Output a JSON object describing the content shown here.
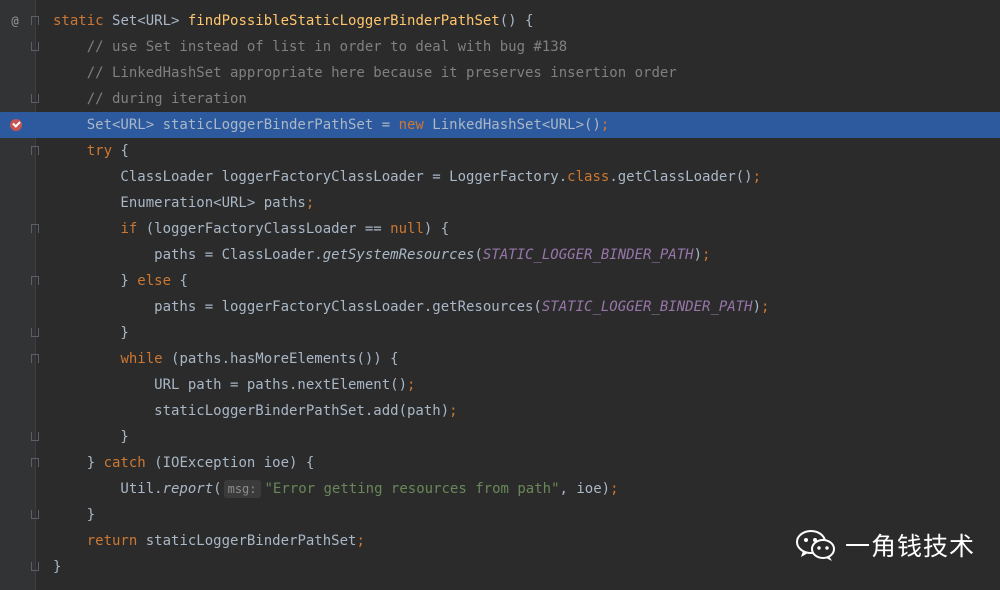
{
  "editor": {
    "lines": [
      {
        "segments": [
          {
            "t": "static ",
            "c": "kw"
          },
          {
            "t": "Set<URL> ",
            "c": ""
          },
          {
            "t": "findPossibleStaticLoggerBinderPathSet",
            "c": "fn"
          },
          {
            "t": "() {",
            "c": ""
          }
        ],
        "gutter": "@",
        "fold": "open"
      },
      {
        "segments": [
          {
            "t": "    // use Set instead of list in order to deal with bug #138",
            "c": "cm"
          }
        ],
        "fold": "line"
      },
      {
        "segments": [
          {
            "t": "    // LinkedHashSet appropriate here because it preserves insertion order",
            "c": "cm"
          }
        ]
      },
      {
        "segments": [
          {
            "t": "    // during iteration",
            "c": "cm"
          }
        ],
        "fold": "close"
      },
      {
        "segments": [
          {
            "t": "    Set<URL> staticLoggerBinderPathSet = ",
            "c": ""
          },
          {
            "t": "new ",
            "c": "kw"
          },
          {
            "t": "LinkedHashSet<URL>()",
            "c": ""
          },
          {
            "t": ";",
            "c": "kw"
          }
        ],
        "breakpoint": true,
        "highlight": true
      },
      {
        "segments": [
          {
            "t": "    ",
            "c": ""
          },
          {
            "t": "try",
            "c": "kw"
          },
          {
            "t": " {",
            "c": ""
          }
        ],
        "fold": "open"
      },
      {
        "segments": [
          {
            "t": "        ClassLoader loggerFactoryClassLoader = LoggerFactory.",
            "c": ""
          },
          {
            "t": "class",
            "c": "kw"
          },
          {
            "t": ".getClassLoader()",
            "c": ""
          },
          {
            "t": ";",
            "c": "kw"
          }
        ]
      },
      {
        "segments": [
          {
            "t": "        Enumeration<URL> paths",
            "c": ""
          },
          {
            "t": ";",
            "c": "kw"
          }
        ]
      },
      {
        "segments": [
          {
            "t": "        ",
            "c": ""
          },
          {
            "t": "if",
            "c": "kw"
          },
          {
            "t": " (loggerFactoryClassLoader == ",
            "c": ""
          },
          {
            "t": "null",
            "c": "kw"
          },
          {
            "t": ") {",
            "c": ""
          }
        ],
        "fold": "open"
      },
      {
        "segments": [
          {
            "t": "            paths = ClassLoader.",
            "c": ""
          },
          {
            "t": "getSystemResources",
            "c": "it"
          },
          {
            "t": "(",
            "c": ""
          },
          {
            "t": "STATIC_LOGGER_BINDER_PATH",
            "c": "st"
          },
          {
            "t": ")",
            "c": ""
          },
          {
            "t": ";",
            "c": "kw"
          }
        ]
      },
      {
        "segments": [
          {
            "t": "        } ",
            "c": ""
          },
          {
            "t": "else",
            "c": "kw"
          },
          {
            "t": " {",
            "c": ""
          }
        ],
        "fold": "open"
      },
      {
        "segments": [
          {
            "t": "            paths = loggerFactoryClassLoader.getResources(",
            "c": ""
          },
          {
            "t": "STATIC_LOGGER_BINDER_PATH",
            "c": "st"
          },
          {
            "t": ")",
            "c": ""
          },
          {
            "t": ";",
            "c": "kw"
          }
        ]
      },
      {
        "segments": [
          {
            "t": "        }",
            "c": ""
          }
        ],
        "fold": "close"
      },
      {
        "segments": [
          {
            "t": "        ",
            "c": ""
          },
          {
            "t": "while",
            "c": "kw"
          },
          {
            "t": " (paths.hasMoreElements()) {",
            "c": ""
          }
        ],
        "fold": "open"
      },
      {
        "segments": [
          {
            "t": "            URL path = paths.nextElement()",
            "c": ""
          },
          {
            "t": ";",
            "c": "kw"
          }
        ]
      },
      {
        "segments": [
          {
            "t": "            staticLoggerBinderPathSet.add(path)",
            "c": ""
          },
          {
            "t": ";",
            "c": "kw"
          }
        ]
      },
      {
        "segments": [
          {
            "t": "        }",
            "c": ""
          }
        ],
        "fold": "close"
      },
      {
        "segments": [
          {
            "t": "    } ",
            "c": ""
          },
          {
            "t": "catch",
            "c": "kw"
          },
          {
            "t": " (IOException ioe) {",
            "c": ""
          }
        ],
        "fold": "open"
      },
      {
        "segments": [
          {
            "t": "        Util.",
            "c": ""
          },
          {
            "t": "report",
            "c": "it"
          },
          {
            "t": "(",
            "c": ""
          },
          {
            "t": "msg:",
            "c": "hint"
          },
          {
            "t": "\"Error getting resources from path\"",
            "c": "str"
          },
          {
            "t": ", ioe)",
            "c": ""
          },
          {
            "t": ";",
            "c": "kw"
          }
        ]
      },
      {
        "segments": [
          {
            "t": "    }",
            "c": ""
          }
        ],
        "fold": "close"
      },
      {
        "segments": [
          {
            "t": "    ",
            "c": ""
          },
          {
            "t": "return ",
            "c": "kw"
          },
          {
            "t": "staticLoggerBinderPathSet",
            "c": ""
          },
          {
            "t": ";",
            "c": "kw"
          }
        ]
      },
      {
        "segments": [
          {
            "t": "}",
            "c": ""
          }
        ],
        "fold": "close"
      }
    ]
  },
  "watermark": {
    "text": "一角钱技术",
    "icon": "wechat-icon"
  },
  "colors": {
    "background": "#2b2b2b",
    "highlight": "#2d5a9e",
    "keyword": "#cc7832",
    "comment": "#808080",
    "method": "#ffc66d",
    "constant": "#9876aa",
    "string": "#6a8759",
    "text": "#a9b7c6",
    "breakpoint": "#c75450"
  }
}
